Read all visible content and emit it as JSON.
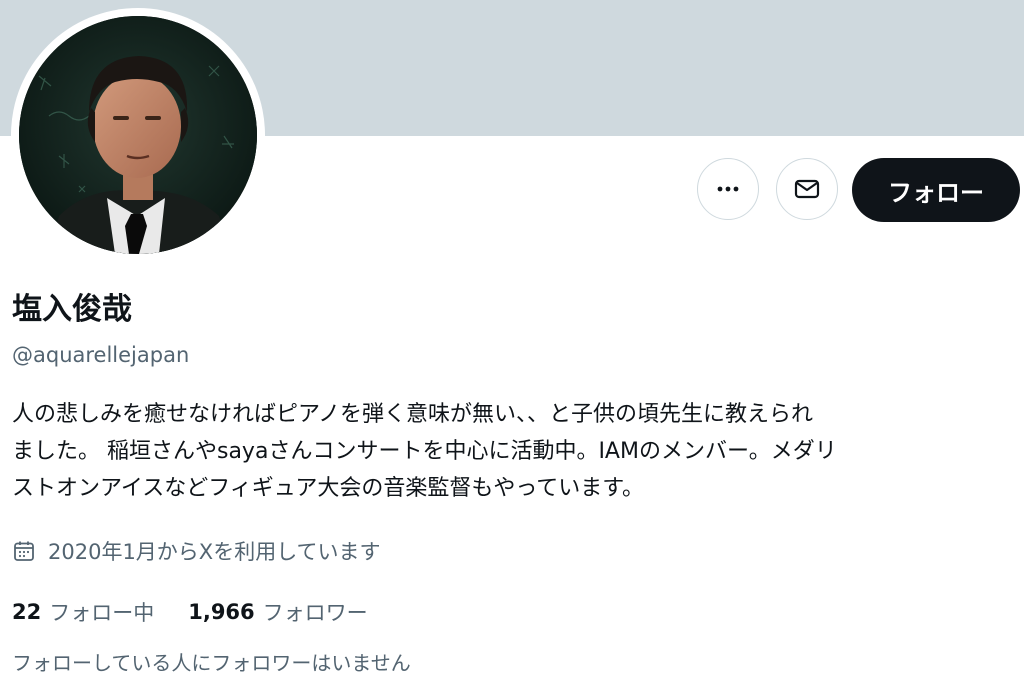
{
  "profile": {
    "display_name": "塩入俊哉",
    "handle": "@aquarellejapan",
    "bio_lines": [
      "人の悲しみを癒せなければピアノを弾く意味が無い、、と子供の頃先生に教えられ",
      "ました。 稲垣さんやsayaさんコンサートを中心に活動中。IAMのメンバー。メダリ",
      "ストオンアイスなどフィギュア大会の音楽監督もやっています。"
    ],
    "joined_text": "2020年1月からXを利用しています",
    "following_count": "22",
    "following_label": "フォロー中",
    "followers_count": "1,966",
    "followers_label": "フォロワー",
    "mutual_note": "フォローしている人にフォロワーはいません"
  },
  "actions": {
    "more_icon": "more-dots-icon",
    "message_icon": "envelope-icon",
    "follow_label": "フォロー"
  },
  "icons": {
    "joined": "calendar-icon",
    "avatar": "profile-photo"
  },
  "colors": {
    "banner": "#cfd9de",
    "text_primary": "#0f1419",
    "text_secondary": "#536471",
    "follow_button_bg": "#0f1419",
    "follow_button_text": "#ffffff",
    "button_border": "#cfd9de"
  }
}
